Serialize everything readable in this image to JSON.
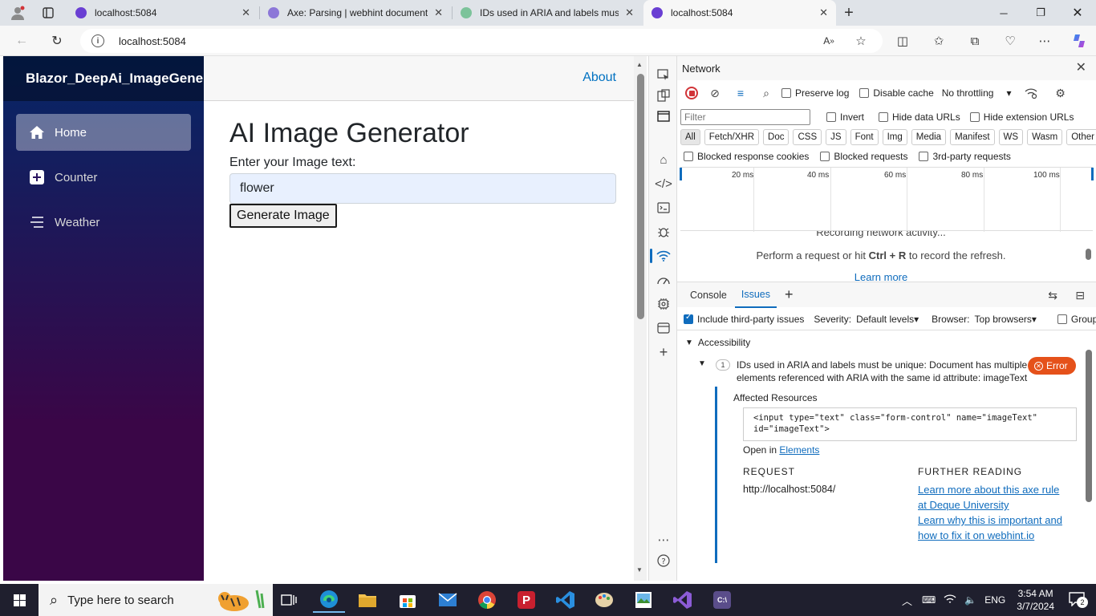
{
  "browser": {
    "tabs": [
      {
        "label": "localhost:5084",
        "active": false,
        "favicon_color": "#6a3fd3"
      },
      {
        "label": "Axe: Parsing | webhint documentati",
        "active": false,
        "favicon_color": "#8c77d8"
      },
      {
        "label": "IDs used in ARIA and labels must b",
        "active": false,
        "favicon_color": "#7cc39a"
      },
      {
        "label": "localhost:5084",
        "active": true,
        "favicon_color": "#6a3fd3"
      }
    ],
    "url": "localhost:5084"
  },
  "app": {
    "brand": "Blazor_DeepAi_ImageGenerator",
    "nav": [
      {
        "label": "Home",
        "icon": "house-icon",
        "active": true
      },
      {
        "label": "Counter",
        "icon": "plus-square-icon",
        "active": false
      },
      {
        "label": "Weather",
        "icon": "list-icon",
        "active": false
      }
    ],
    "about": "About",
    "title": "AI Image Generator",
    "prompt_label": "Enter your Image text:",
    "input_value": "flower",
    "button": "Generate Image"
  },
  "devtools": {
    "panel_title": "Network",
    "toolbar": {
      "preserve_log": "Preserve log",
      "disable_cache": "Disable cache",
      "throttling": "No throttling"
    },
    "filter": {
      "placeholder": "Filter",
      "invert": "Invert",
      "hide_data_urls": "Hide data URLs",
      "hide_extension_urls": "Hide extension URLs"
    },
    "types": [
      "All",
      "Fetch/XHR",
      "Doc",
      "CSS",
      "JS",
      "Font",
      "Img",
      "Media",
      "Manifest",
      "WS",
      "Wasm",
      "Other"
    ],
    "blocked": [
      "Blocked response cookies",
      "Blocked requests",
      "3rd-party requests"
    ],
    "timeline_ticks": [
      "20 ms",
      "40 ms",
      "60 ms",
      "80 ms",
      "100 ms"
    ],
    "recording": {
      "line1": "Recording network activity...",
      "line2_pre": "Perform a request or hit ",
      "line2_key": "Ctrl + R",
      "line2_post": " to record the refresh.",
      "line3": "Learn more"
    },
    "drawer_tabs": [
      "Console",
      "Issues"
    ],
    "issues": {
      "include_third_party": "Include third-party issues",
      "severity_label": "Severity:",
      "severity_value": "Default levels",
      "browser_label": "Browser:",
      "browser_value": "Top browsers",
      "group": "Group",
      "category": "Accessibility",
      "count": "1",
      "issue_text": "IDs used in ARIA and labels must be unique: Document has multiple elements referenced with ARIA with the same id attribute: imageText",
      "severity_badge": "Error",
      "affected": "Affected Resources",
      "code_line1": "<input type=\"text\" class=\"form-control\" name=\"imageText\"",
      "code_line2": "id=\"imageText\">",
      "open_in": "Open in",
      "open_in_link": "Elements",
      "request_head": "REQUEST",
      "request_url": "http://localhost:5084/",
      "further_head": "FURTHER READING",
      "link1": "Learn more about this axe rule at Deque University",
      "link2": "Learn why this is important and how to fix it on webhint.io"
    }
  },
  "taskbar": {
    "search_placeholder": "Type here to search",
    "language": "ENG",
    "time": "3:54 AM",
    "date": "3/7/2024",
    "notifications": "2"
  }
}
